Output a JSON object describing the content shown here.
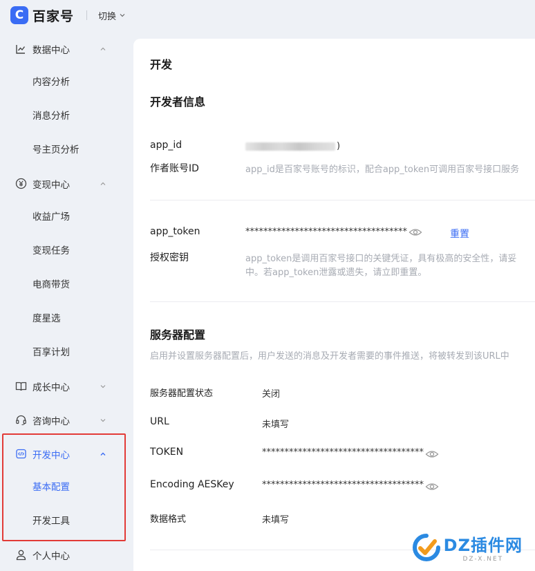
{
  "header": {
    "logo_letter": "C",
    "logo_text": "百家号",
    "switch_label": "切换"
  },
  "sidebar": {
    "groups": [
      {
        "label": "数据中心",
        "icon": "chart-icon",
        "expanded": true,
        "items": [
          "内容分析",
          "消息分析",
          "号主页分析"
        ]
      },
      {
        "label": "变现中心",
        "icon": "yen-icon",
        "expanded": true,
        "items": [
          "收益广场",
          "变现任务",
          "电商带货",
          "度星选",
          "百享计划"
        ]
      },
      {
        "label": "成长中心",
        "icon": "book-icon",
        "expanded": false,
        "items": []
      },
      {
        "label": "咨询中心",
        "icon": "headset-icon",
        "expanded": false,
        "items": []
      },
      {
        "label": "开发中心",
        "icon": "code-icon",
        "expanded": true,
        "active": true,
        "items": [
          "基本配置",
          "开发工具"
        ],
        "active_item": "基本配置"
      },
      {
        "label": "个人中心",
        "icon": "user-icon",
        "expanded": false,
        "items": []
      }
    ]
  },
  "main": {
    "page_title": "开发",
    "dev_info": {
      "title": "开发者信息",
      "app_id": {
        "label": "app_id",
        "sublabel": "作者账号ID",
        "value_masked": true,
        "value_tail": ")",
        "desc": "app_id是百家号账号的标识，配合app_token可调用百家号接口服务"
      },
      "app_token": {
        "label": "app_token",
        "sublabel": "授权密钥",
        "value": "************************************",
        "reset_label": "重置",
        "desc_line1": "app_token是调用百家号接口的关键凭证，具有极高的安全性，请妥",
        "desc_line2": "中。若app_token泄露或遗失，请立即重置。"
      }
    },
    "server": {
      "title": "服务器配置",
      "desc": "启用并设置服务器配置后，用户发送的消息及开发者需要的事件推送，将被转发到该URL中",
      "rows": [
        {
          "label": "服务器配置状态",
          "value": "关闭",
          "has_eye": false
        },
        {
          "label": "URL",
          "value": "未填写",
          "has_eye": false
        },
        {
          "label": "TOKEN",
          "value": "************************************",
          "has_eye": true
        },
        {
          "label": "Encoding AESKey",
          "value": "************************************",
          "has_eye": true
        },
        {
          "label": "数据格式",
          "value": "未填写",
          "has_eye": false
        }
      ]
    }
  },
  "watermark": {
    "title": "DZ插件网",
    "sub": "DZ-X.NET"
  },
  "colors": {
    "accent": "#3a6cf4",
    "highlight_box": "#e23a36",
    "sidebar_bg": "#eef1f6"
  }
}
